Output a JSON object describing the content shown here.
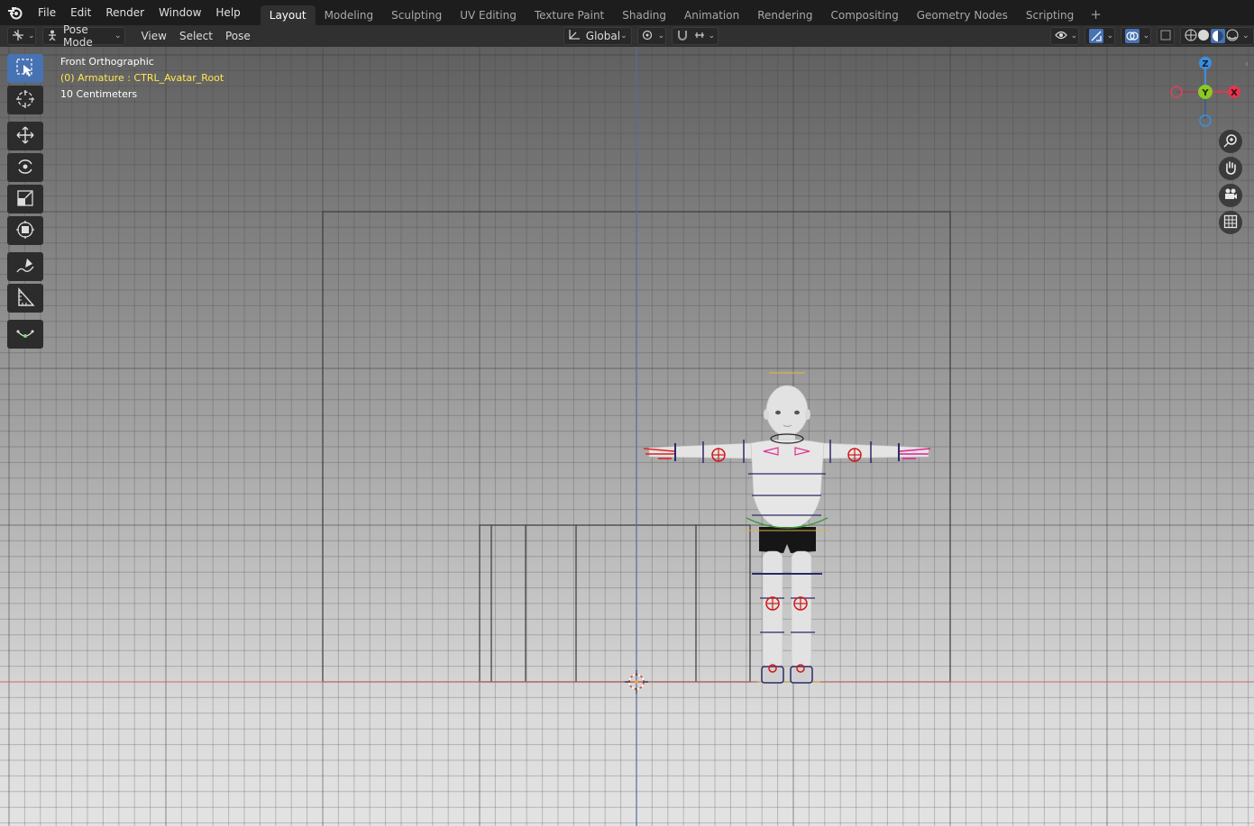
{
  "menu": {
    "items": [
      "File",
      "Edit",
      "Render",
      "Window",
      "Help"
    ]
  },
  "workspaces": {
    "tabs": [
      "Layout",
      "Modeling",
      "Sculpting",
      "UV Editing",
      "Texture Paint",
      "Shading",
      "Animation",
      "Rendering",
      "Compositing",
      "Geometry Nodes",
      "Scripting"
    ],
    "active": "Layout"
  },
  "header": {
    "mode": "Pose Mode",
    "menus": [
      "View",
      "Select",
      "Pose"
    ],
    "orientation": "Global"
  },
  "overlay": {
    "view_name": "Front Orthographic",
    "object_info": "(0) Armature : CTRL_Avatar_Root",
    "scale": "10 Centimeters"
  },
  "gizmo": {
    "z": "Z",
    "y": "Y",
    "x": "X"
  },
  "colors": {
    "active_tab": "#303030",
    "accent": "#4772b3",
    "x_axis": "#e0374f",
    "y_axis": "#8ac926",
    "z_axis": "#3e8ede",
    "object_info": "#ffe84f"
  },
  "icons": {
    "toolbar": [
      "select-box-icon",
      "cursor-icon",
      "move-icon",
      "rotate-icon",
      "scale-icon",
      "transform-icon",
      "annotate-icon",
      "measure-icon",
      "bone-relax-icon"
    ],
    "nav": [
      "zoom-icon",
      "pan-hand-icon",
      "camera-icon",
      "grid-icon"
    ]
  }
}
